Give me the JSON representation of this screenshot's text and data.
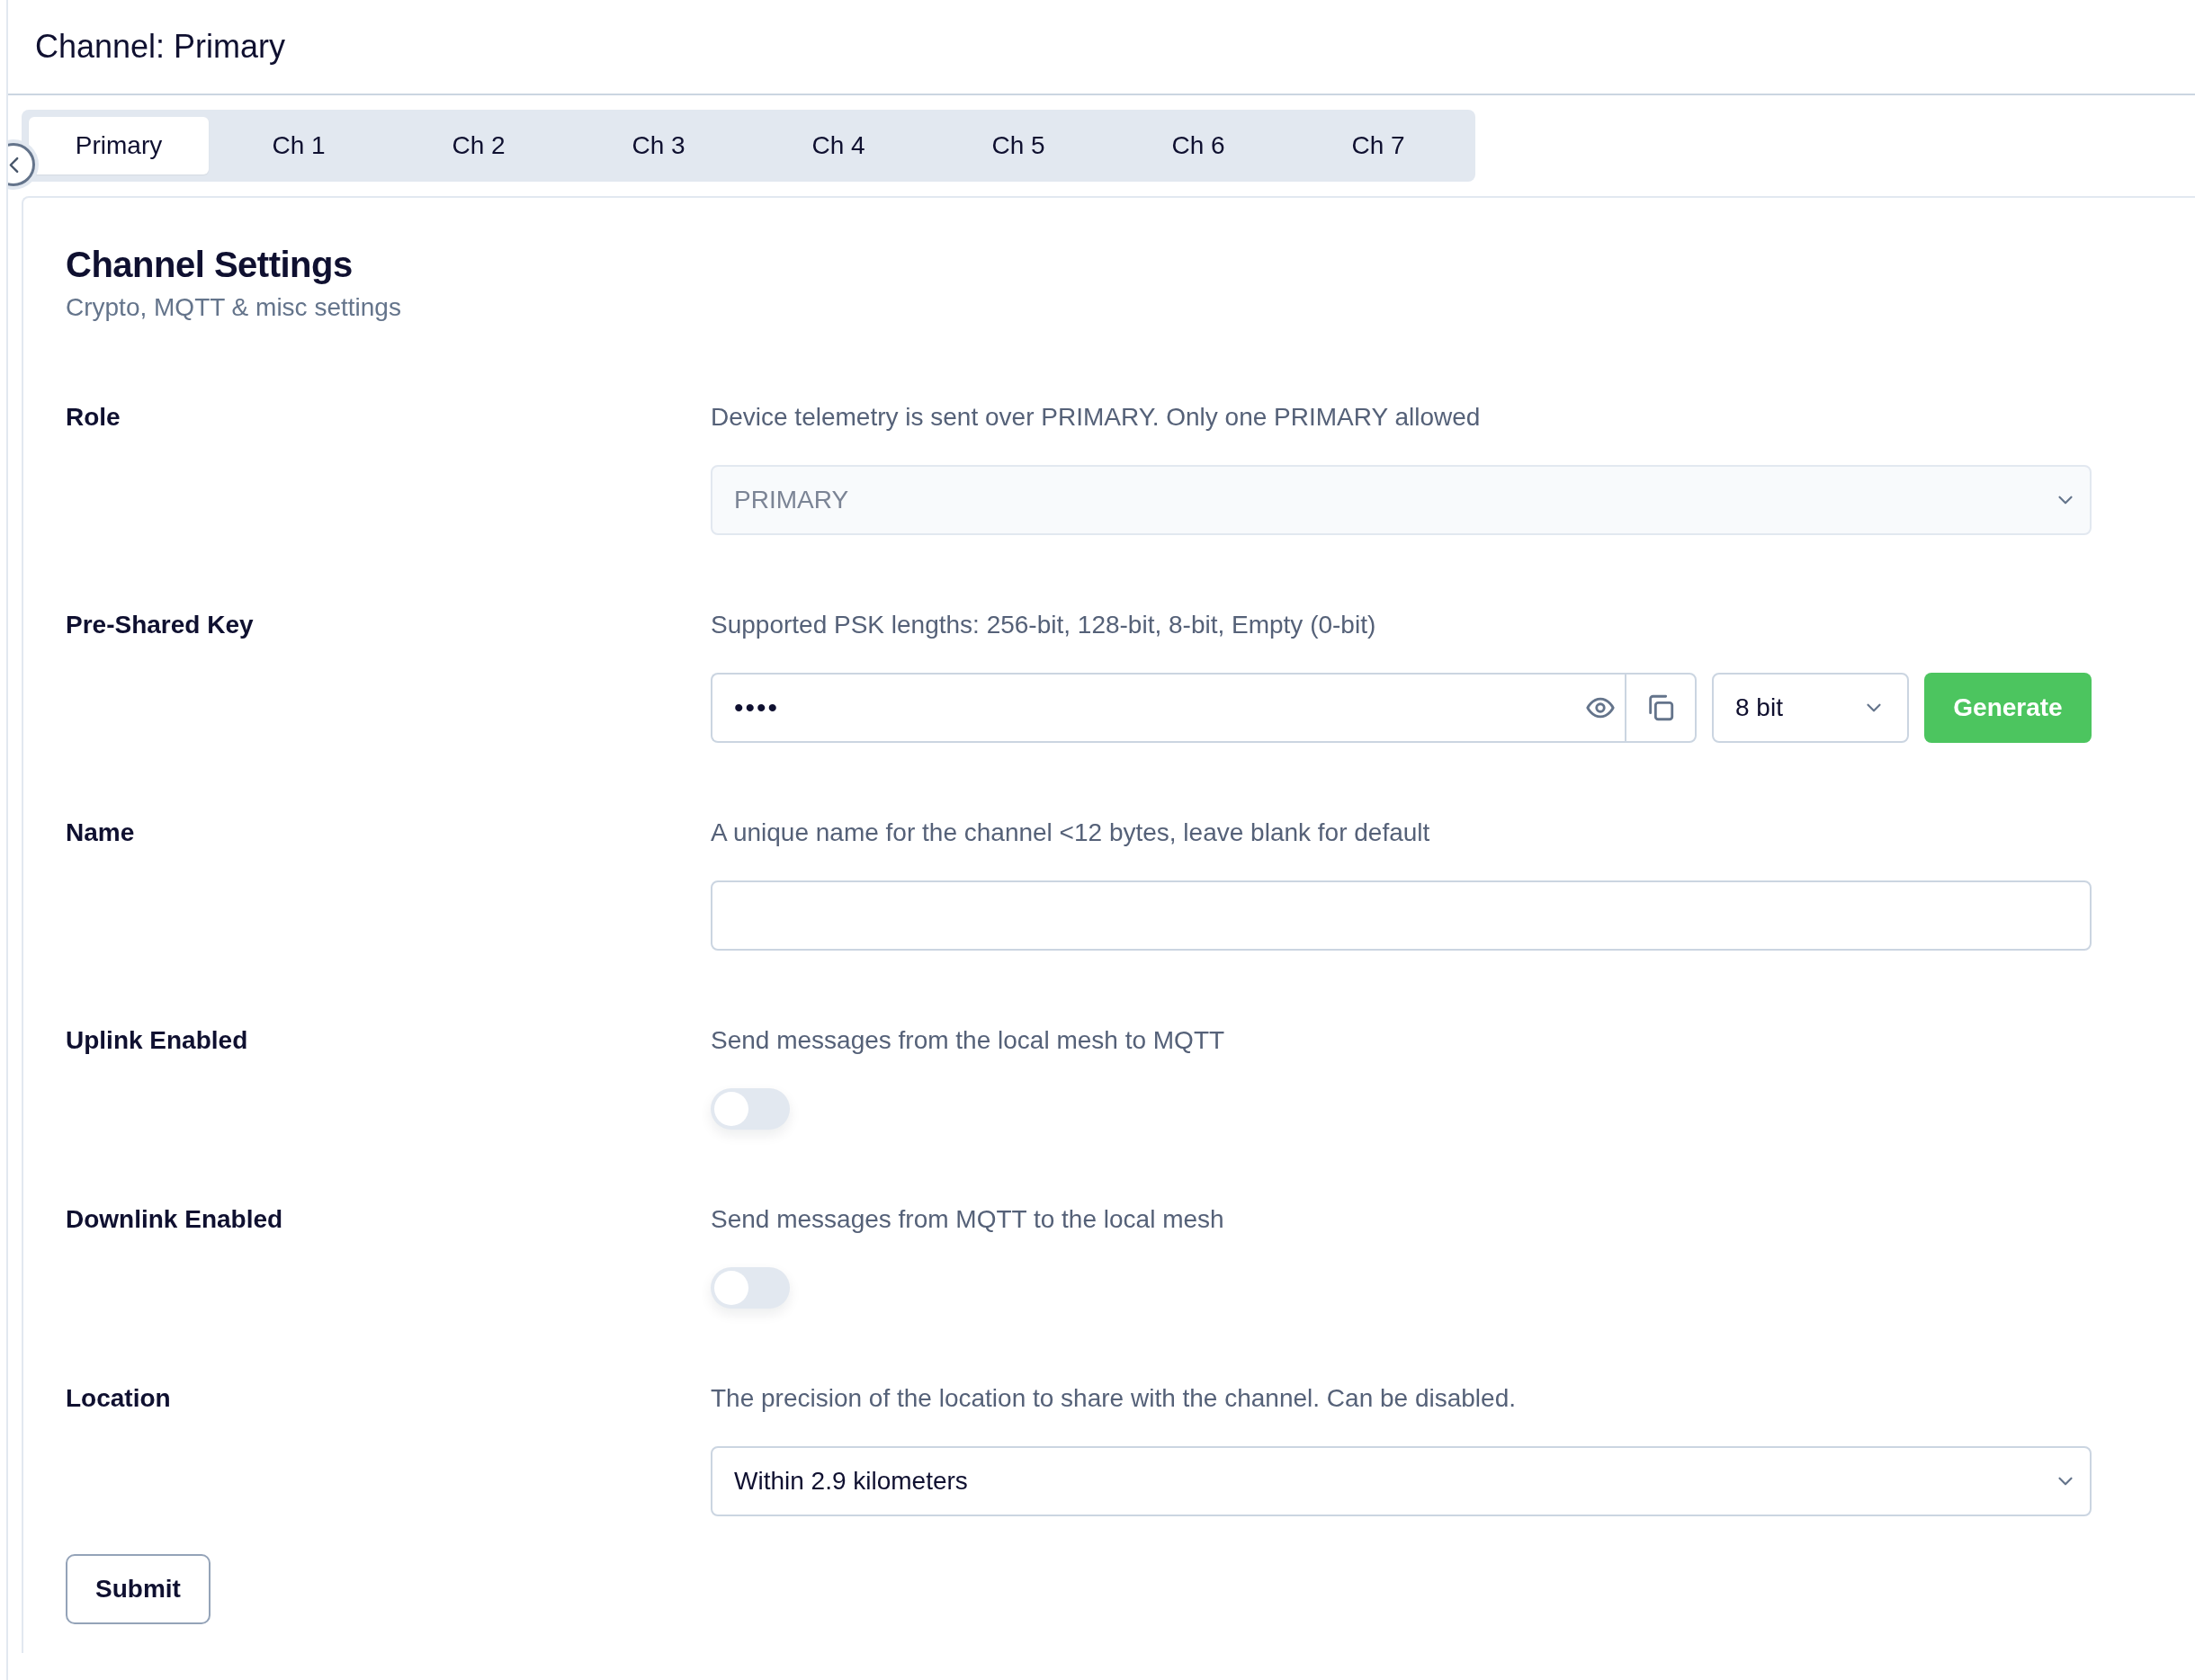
{
  "header": {
    "title": "Channel: Primary"
  },
  "tabs": [
    {
      "label": "Primary",
      "selected": true
    },
    {
      "label": "Ch 1",
      "selected": false
    },
    {
      "label": "Ch 2",
      "selected": false
    },
    {
      "label": "Ch 3",
      "selected": false
    },
    {
      "label": "Ch 4",
      "selected": false
    },
    {
      "label": "Ch 5",
      "selected": false
    },
    {
      "label": "Ch 6",
      "selected": false
    },
    {
      "label": "Ch 7",
      "selected": false
    }
  ],
  "section": {
    "title": "Channel Settings",
    "subtitle": "Crypto, MQTT & misc settings"
  },
  "fields": [
    {
      "kind": "select",
      "label": "Role",
      "description": "Device telemetry is sent over PRIMARY. Only one PRIMARY allowed",
      "value": "PRIMARY",
      "disabled": true
    },
    {
      "kind": "psk",
      "label": "Pre-Shared Key",
      "description": "Supported PSK lengths: 256-bit, 128-bit, 8-bit, Empty (0-bit)",
      "value": "••••",
      "bits": "8 bit",
      "button": "Generate"
    },
    {
      "kind": "text",
      "label": "Name",
      "description": "A unique name for the channel <12 bytes, leave blank for default"
    },
    {
      "kind": "toggle",
      "label": "Uplink Enabled",
      "description": "Send messages from the local mesh to MQTT",
      "on": false
    },
    {
      "kind": "toggle",
      "label": "Downlink Enabled",
      "description": "Send messages from MQTT to the local mesh",
      "on": false
    },
    {
      "kind": "select",
      "label": "Location",
      "description": "The precision of the location to share with the channel. Can be disabled.",
      "value": "Within 2.9 kilometers",
      "disabled": false
    }
  ],
  "submit": "Submit"
}
